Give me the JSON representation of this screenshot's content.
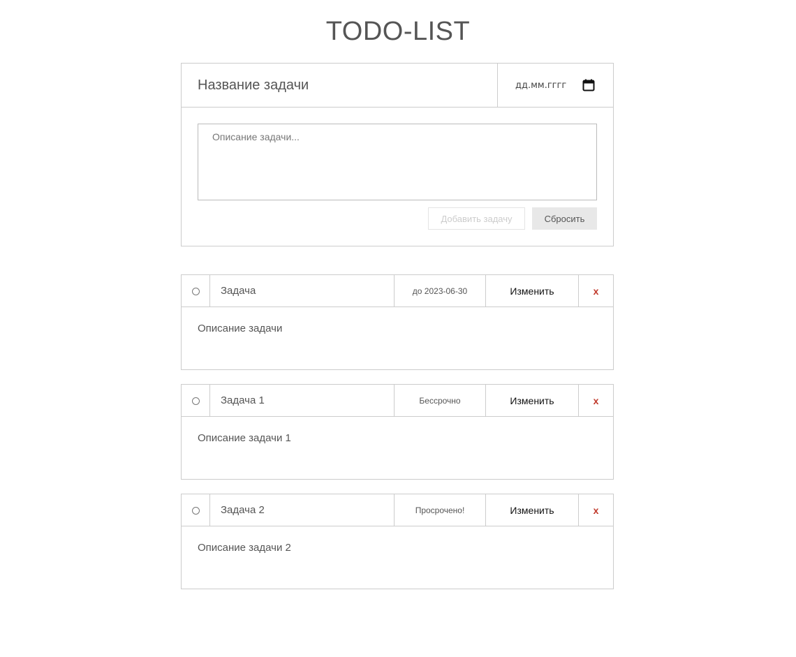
{
  "page": {
    "title": "TODO-LIST"
  },
  "form": {
    "title_placeholder": "Название задачи",
    "date_placeholder": "дд.мм.гггг",
    "description_placeholder": "Описание задачи...",
    "add_button": "Добавить задачу",
    "reset_button": "Сбросить"
  },
  "tasks": [
    {
      "name": "Задача",
      "deadline": "до 2023-06-30",
      "edit_label": "Изменить",
      "delete_label": "x",
      "description": "Описание задачи"
    },
    {
      "name": "Задача 1",
      "deadline": "Бессрочно",
      "edit_label": "Изменить",
      "delete_label": "x",
      "description": "Описание задачи 1"
    },
    {
      "name": "Задача 2",
      "deadline": "Просрочено!",
      "edit_label": "Изменить",
      "delete_label": "x",
      "description": "Описание задачи 2"
    }
  ],
  "colors": {
    "text": "#555555",
    "border": "#cccccc",
    "delete": "#c0392b",
    "reset_bg": "#e8e8e8"
  },
  "icons": {
    "date_picker": "calendar-icon",
    "task_toggle": "radio-circle-icon"
  }
}
